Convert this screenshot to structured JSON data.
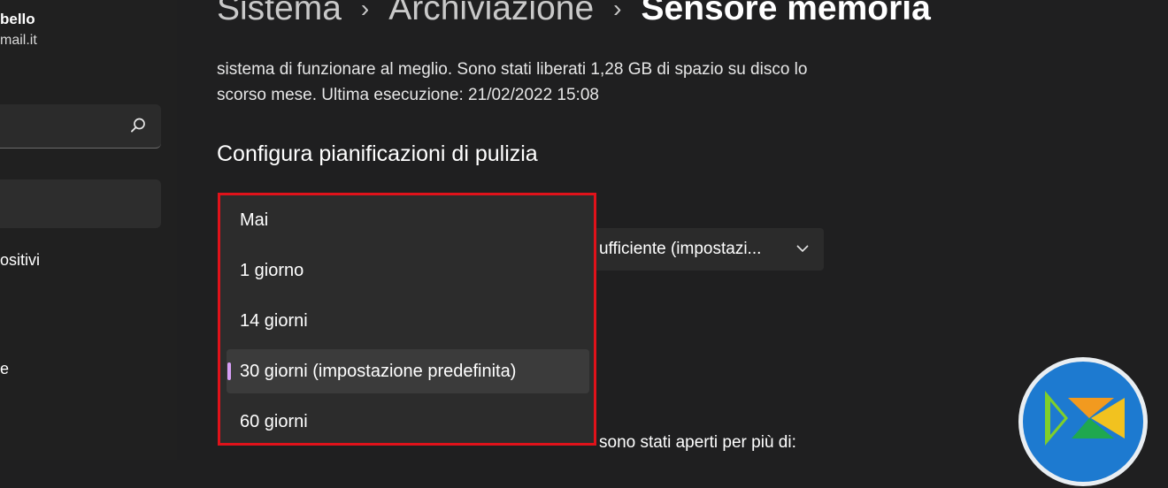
{
  "user": {
    "name": "bello",
    "email": "mail.it"
  },
  "sidebar": {
    "search_icon": "search-icon",
    "items": [
      {
        "label": "ositivi"
      },
      {
        "label": "e"
      }
    ]
  },
  "breadcrumb": {
    "items": [
      "Sistema",
      "Archiviazione",
      "Sensore memoria"
    ],
    "separator": "›"
  },
  "description": "sistema di funzionare al meglio. Sono stati liberati 1,28 GB di spazio su disco lo scorso mese. Ultima esecuzione: 21/02/2022 15:08",
  "section": {
    "title": "Configura pianificazioni di pulizia"
  },
  "select": {
    "value": "ufficiente (impostazi...",
    "icon": "chevron-down-icon"
  },
  "bottom_text": "sono stati aperti per più di:",
  "dropdown": {
    "options": [
      {
        "label": "Mai"
      },
      {
        "label": "1 giorno"
      },
      {
        "label": "14 giorni"
      },
      {
        "label": "30 giorni (impostazione predefinita)",
        "selected": true
      },
      {
        "label": "60 giorni"
      }
    ],
    "highlight_color": "#e0121a",
    "accent_color": "#d69ef5"
  },
  "colors": {
    "background": "#1f1f20",
    "panel": "#2c2c2c"
  }
}
